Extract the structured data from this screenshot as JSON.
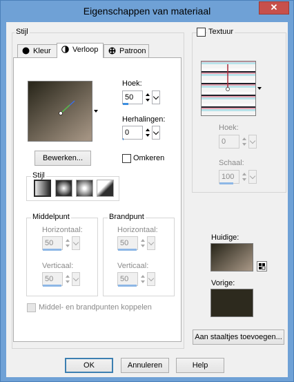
{
  "window": {
    "title": "Eigenschappen van materiaal",
    "close_glyph": "✕"
  },
  "left": {
    "group_label": "Stijl",
    "tabs": [
      {
        "label": "Kleur",
        "icon": "circle-icon",
        "active": false
      },
      {
        "label": "Verloop",
        "icon": "half-circle-icon",
        "active": true
      },
      {
        "label": "Patroon",
        "icon": "pattern-icon",
        "active": false
      }
    ],
    "gradient": {
      "start_color": "#a39382",
      "end_color": "#2d2a1e",
      "angle_label": "Hoek:",
      "angle_value": "50",
      "repeats_label": "Herhalingen:",
      "repeats_value": "0",
      "edit_button": "Bewerken...",
      "invert_label": "Omkeren",
      "invert_checked": false,
      "style_label": "Stijl",
      "styles": [
        "linear-style-icon",
        "rectangular-style-icon",
        "radial-style-icon",
        "sunburst-style-icon"
      ],
      "selected_style": 0
    },
    "centerpoint": {
      "label": "Middelpunt",
      "horizontal_label": "Horizontaal:",
      "horizontal_value": "50",
      "vertical_label": "Verticaal:",
      "vertical_value": "50"
    },
    "focalpoint": {
      "label": "Brandpunt",
      "horizontal_label": "Horizontaal:",
      "horizontal_value": "50",
      "vertical_label": "Verticaal:",
      "vertical_value": "50"
    },
    "link_label": "Middel- en brandpunten koppelen"
  },
  "right": {
    "texture_label": "Textuur",
    "texture_checked": false,
    "angle_label": "Hoek:",
    "angle_value": "0",
    "scale_label": "Schaal:",
    "scale_value": "100",
    "current_label": "Huidige:",
    "previous_label": "Vorige:",
    "previous_color": "#2d2a1e",
    "add_swatch_button": "Aan staaltjes toevoegen..."
  },
  "footer": {
    "ok": "OK",
    "cancel": "Annuleren",
    "help": "Help"
  }
}
